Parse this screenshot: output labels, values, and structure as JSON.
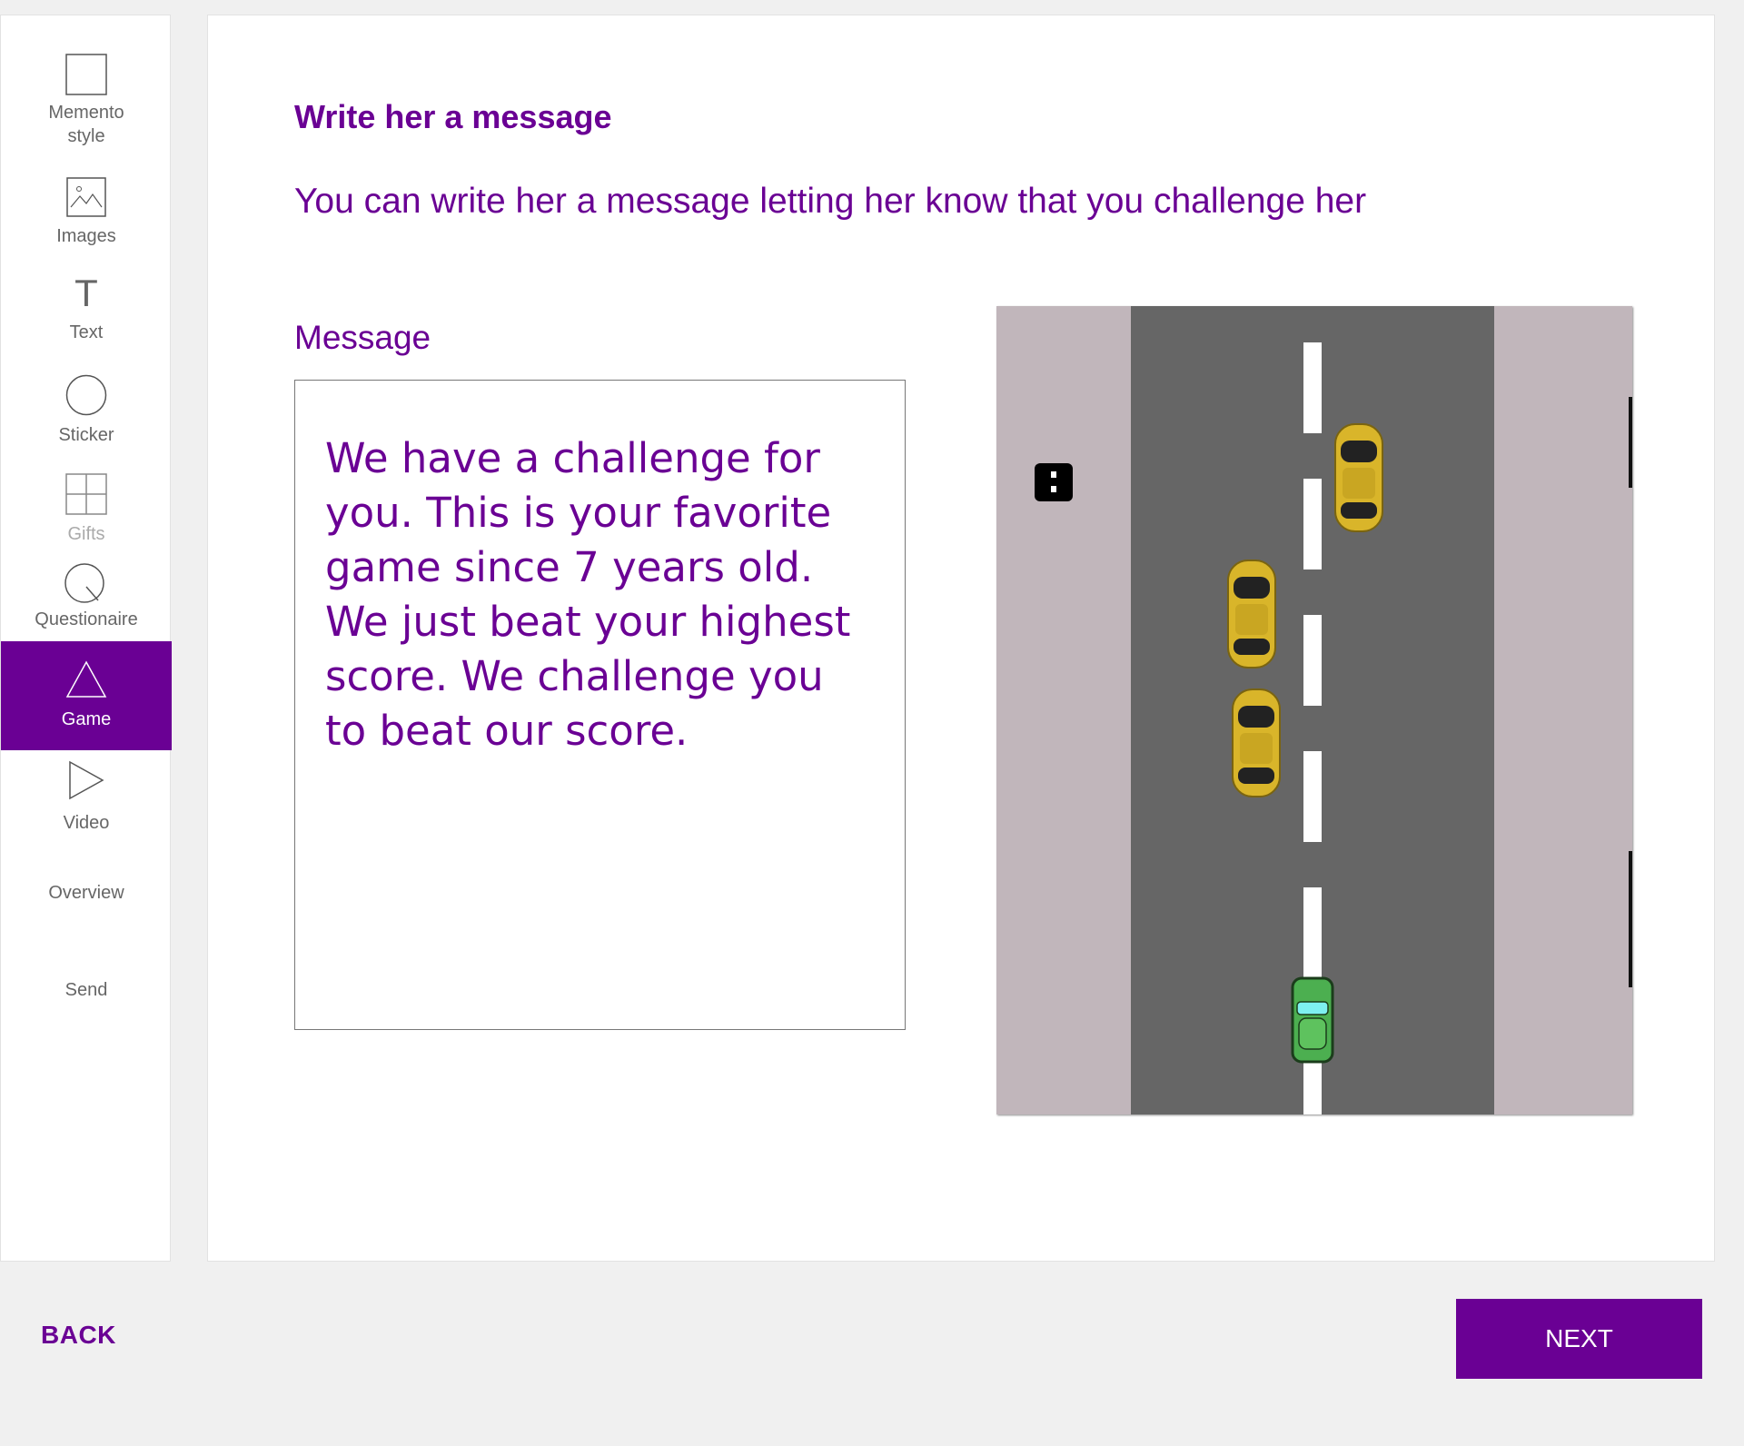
{
  "sidebar": {
    "items": [
      {
        "label": "Memento style",
        "icon": "square-icon"
      },
      {
        "label": "Images",
        "icon": "image-icon"
      },
      {
        "label": "Text",
        "icon": "text-icon"
      },
      {
        "label": "Sticker",
        "icon": "circle-icon"
      },
      {
        "label": "Gifts",
        "icon": "grid-icon",
        "state": "disabled"
      },
      {
        "label": "Questionaire",
        "icon": "magnifier-icon"
      },
      {
        "label": "Game",
        "icon": "triangle-icon",
        "state": "active"
      },
      {
        "label": "Video",
        "icon": "play-icon"
      },
      {
        "label": "Overview"
      },
      {
        "label": "Send"
      }
    ],
    "text_icon_glyph": "T"
  },
  "main": {
    "title": "Write her a message",
    "subtitle": "You can write her a message letting her know that you challenge her",
    "message_label": "Message",
    "message_value": "We have a challenge for you. This is your favorite game since 7 years old. We just beat your highest score. We challenge you to beat our score."
  },
  "game": {
    "description": "car racing game preview",
    "colors": {
      "sidewalk": "#c1b6bb",
      "road": "#666666",
      "lane": "#ffffff",
      "enemy_car": "#d9b52a",
      "player_car": "#4caf50"
    }
  },
  "footer": {
    "back_label": "BACK",
    "next_label": "NEXT"
  },
  "colors": {
    "accent": "#6a0094",
    "background": "#f0f0f0"
  }
}
